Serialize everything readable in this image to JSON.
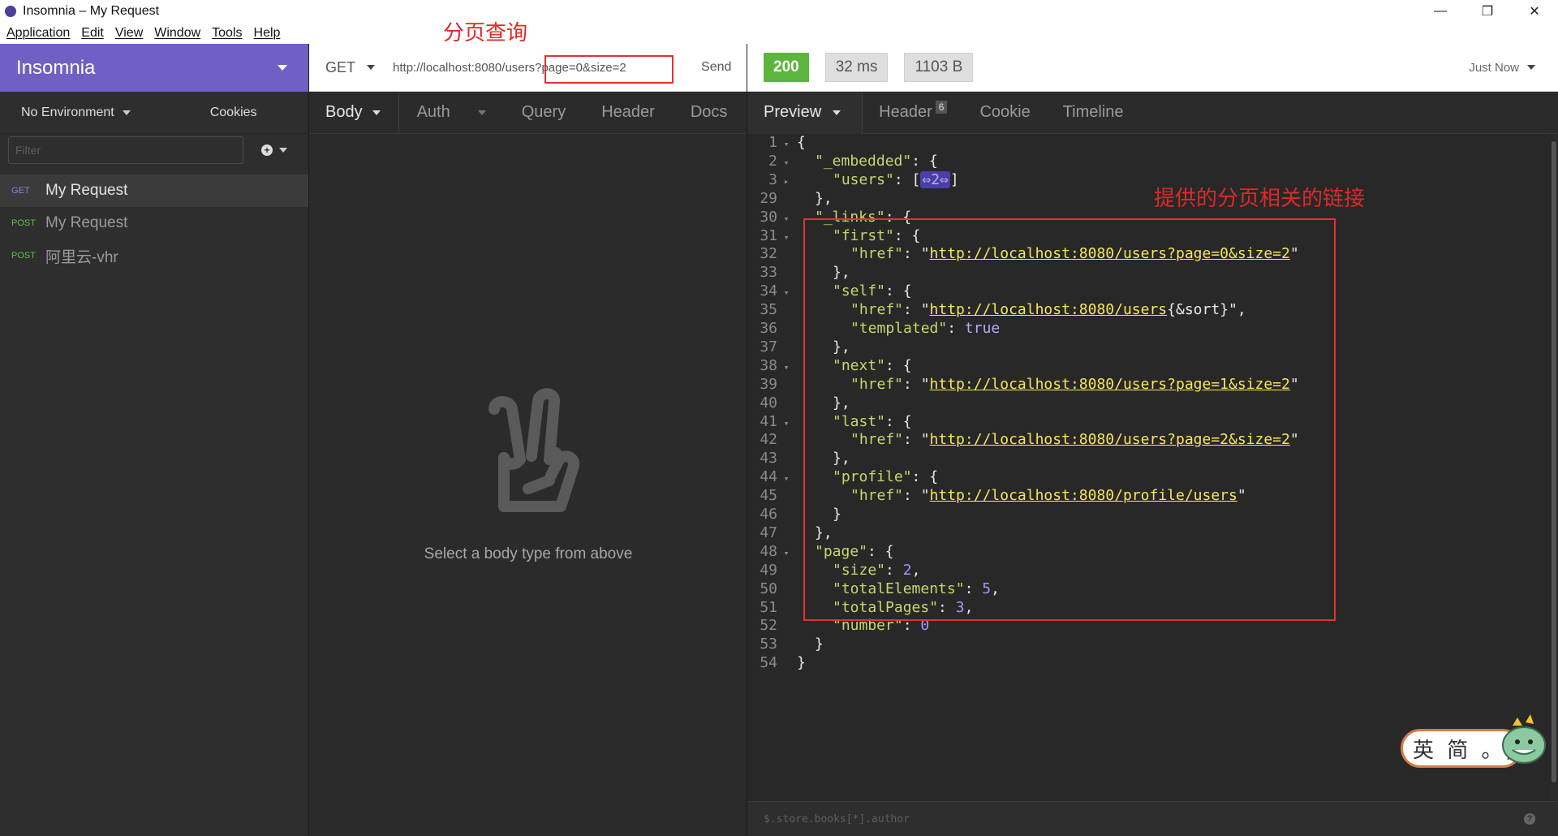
{
  "window": {
    "title": "Insomnia – My Request",
    "min": "—",
    "max": "❐",
    "close": "✕"
  },
  "menu": [
    "Application",
    "Edit",
    "View",
    "Window",
    "Tools",
    "Help"
  ],
  "sidebar": {
    "title": "Insomnia",
    "environment": "No Environment",
    "cookies": "Cookies",
    "filter_placeholder": "Filter",
    "requests": [
      {
        "method": "GET",
        "name": "My Request"
      },
      {
        "method": "POST",
        "name": "My Request"
      },
      {
        "method": "POST",
        "name": "阿里云-vhr"
      }
    ]
  },
  "request": {
    "method": "GET",
    "url": "http://localhost:8080/users?page=0&size=2",
    "send": "Send",
    "tabs": [
      "Body",
      "Auth",
      "Query",
      "Header",
      "Docs"
    ],
    "empty_message": "Select a body type from above"
  },
  "response": {
    "status": "200",
    "time": "32 ms",
    "size": "1103 B",
    "when": "Just Now",
    "tabs": [
      "Preview",
      "Header",
      "Cookie",
      "Timeline"
    ],
    "header_count": "6",
    "filter_placeholder": "$.store.books[*].author",
    "help": "?"
  },
  "annotations": {
    "url_note": "分页查询",
    "links_note": "提供的分页相关的链接"
  },
  "ime": {
    "text": "英 简 。,"
  },
  "code_lines": [
    {
      "n": "1",
      "fold": "▾",
      "indent": 0,
      "parts": [
        [
          "txt",
          "{"
        ]
      ]
    },
    {
      "n": "2",
      "fold": "▾",
      "indent": 1,
      "parts": [
        [
          "k",
          "\"_embedded\""
        ],
        [
          "txt",
          ": {"
        ]
      ]
    },
    {
      "n": "3",
      "fold": "▸",
      "indent": 2,
      "parts": [
        [
          "k",
          "\"users\""
        ],
        [
          "txt",
          ": ["
        ],
        [
          "coll",
          "⇔2⇔"
        ],
        [
          "txt",
          "]"
        ]
      ]
    },
    {
      "n": "29",
      "fold": "",
      "indent": 1,
      "parts": [
        [
          "txt",
          "},"
        ]
      ]
    },
    {
      "n": "30",
      "fold": "▾",
      "indent": 1,
      "parts": [
        [
          "k",
          "\"_links\""
        ],
        [
          "txt",
          ": {"
        ]
      ]
    },
    {
      "n": "31",
      "fold": "▾",
      "indent": 2,
      "parts": [
        [
          "k",
          "\"first\""
        ],
        [
          "txt",
          ": {"
        ]
      ]
    },
    {
      "n": "32",
      "fold": "",
      "indent": 3,
      "parts": [
        [
          "k",
          "\"href\""
        ],
        [
          "txt",
          ": \""
        ],
        [
          "url",
          "http://localhost:8080/users?page=0&size=2"
        ],
        [
          "txt",
          "\""
        ]
      ]
    },
    {
      "n": "33",
      "fold": "",
      "indent": 2,
      "parts": [
        [
          "txt",
          "},"
        ]
      ]
    },
    {
      "n": "34",
      "fold": "▾",
      "indent": 2,
      "parts": [
        [
          "k",
          "\"self\""
        ],
        [
          "txt",
          ": {"
        ]
      ]
    },
    {
      "n": "35",
      "fold": "",
      "indent": 3,
      "parts": [
        [
          "k",
          "\"href\""
        ],
        [
          "txt",
          ": \""
        ],
        [
          "url",
          "http://localhost:8080/users"
        ],
        [
          "txt",
          "{&sort}\","
        ]
      ]
    },
    {
      "n": "36",
      "fold": "",
      "indent": 3,
      "parts": [
        [
          "k",
          "\"templated\""
        ],
        [
          "txt",
          ": "
        ],
        [
          "kw",
          "true"
        ]
      ]
    },
    {
      "n": "37",
      "fold": "",
      "indent": 2,
      "parts": [
        [
          "txt",
          "},"
        ]
      ]
    },
    {
      "n": "38",
      "fold": "▾",
      "indent": 2,
      "parts": [
        [
          "k",
          "\"next\""
        ],
        [
          "txt",
          ": {"
        ]
      ]
    },
    {
      "n": "39",
      "fold": "",
      "indent": 3,
      "parts": [
        [
          "k",
          "\"href\""
        ],
        [
          "txt",
          ": \""
        ],
        [
          "url",
          "http://localhost:8080/users?page=1&size=2"
        ],
        [
          "txt",
          "\""
        ]
      ]
    },
    {
      "n": "40",
      "fold": "",
      "indent": 2,
      "parts": [
        [
          "txt",
          "},"
        ]
      ]
    },
    {
      "n": "41",
      "fold": "▾",
      "indent": 2,
      "parts": [
        [
          "k",
          "\"last\""
        ],
        [
          "txt",
          ": {"
        ]
      ]
    },
    {
      "n": "42",
      "fold": "",
      "indent": 3,
      "parts": [
        [
          "k",
          "\"href\""
        ],
        [
          "txt",
          ": \""
        ],
        [
          "url",
          "http://localhost:8080/users?page=2&size=2"
        ],
        [
          "txt",
          "\""
        ]
      ]
    },
    {
      "n": "43",
      "fold": "",
      "indent": 2,
      "parts": [
        [
          "txt",
          "},"
        ]
      ]
    },
    {
      "n": "44",
      "fold": "▾",
      "indent": 2,
      "parts": [
        [
          "k",
          "\"profile\""
        ],
        [
          "txt",
          ": {"
        ]
      ]
    },
    {
      "n": "45",
      "fold": "",
      "indent": 3,
      "parts": [
        [
          "k",
          "\"href\""
        ],
        [
          "txt",
          ": \""
        ],
        [
          "url",
          "http://localhost:8080/profile/users"
        ],
        [
          "txt",
          "\""
        ]
      ]
    },
    {
      "n": "46",
      "fold": "",
      "indent": 2,
      "parts": [
        [
          "txt",
          "}"
        ]
      ]
    },
    {
      "n": "47",
      "fold": "",
      "indent": 1,
      "parts": [
        [
          "txt",
          "},"
        ]
      ]
    },
    {
      "n": "48",
      "fold": "▾",
      "indent": 1,
      "parts": [
        [
          "k",
          "\"page\""
        ],
        [
          "txt",
          ": {"
        ]
      ]
    },
    {
      "n": "49",
      "fold": "",
      "indent": 2,
      "parts": [
        [
          "k",
          "\"size\""
        ],
        [
          "txt",
          ": "
        ],
        [
          "num",
          "2"
        ],
        [
          "txt",
          ","
        ]
      ]
    },
    {
      "n": "50",
      "fold": "",
      "indent": 2,
      "parts": [
        [
          "k",
          "\"totalElements\""
        ],
        [
          "txt",
          ": "
        ],
        [
          "num",
          "5"
        ],
        [
          "txt",
          ","
        ]
      ]
    },
    {
      "n": "51",
      "fold": "",
      "indent": 2,
      "parts": [
        [
          "k",
          "\"totalPages\""
        ],
        [
          "txt",
          ": "
        ],
        [
          "num",
          "3"
        ],
        [
          "txt",
          ","
        ]
      ]
    },
    {
      "n": "52",
      "fold": "",
      "indent": 2,
      "parts": [
        [
          "k",
          "\"number\""
        ],
        [
          "txt",
          ": "
        ],
        [
          "num",
          "0"
        ]
      ]
    },
    {
      "n": "53",
      "fold": "",
      "indent": 1,
      "parts": [
        [
          "txt",
          "}"
        ]
      ]
    },
    {
      "n": "54",
      "fold": "",
      "indent": 0,
      "parts": [
        [
          "txt",
          "}"
        ]
      ]
    }
  ]
}
